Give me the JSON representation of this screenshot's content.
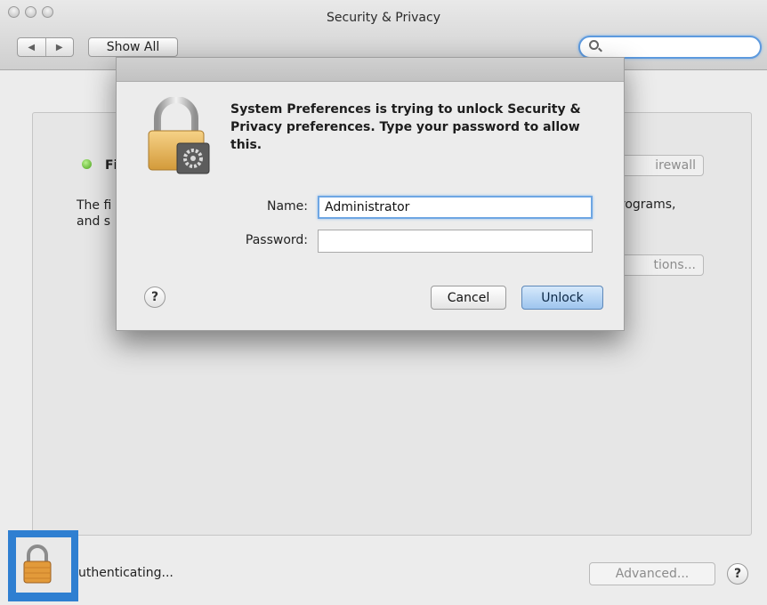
{
  "window": {
    "title": "Security & Privacy",
    "nav_back": "◀",
    "nav_forward": "▶",
    "show_all": "Show All",
    "search_placeholder": ""
  },
  "background": {
    "status_label": "Fi",
    "description_left_line1": "The fi",
    "description_left_line2": "and s",
    "description_right": "programs,",
    "firewall_button": "irewall",
    "options_button": "tions..."
  },
  "bottom": {
    "status": "uthenticating...",
    "advanced_button": "Advanced...",
    "help": "?"
  },
  "dialog": {
    "message": "System Preferences is trying to unlock Security & Privacy preferences. Type your password to allow this.",
    "name_label": "Name:",
    "name_value": "Administrator",
    "password_label": "Password:",
    "password_value": "",
    "help": "?",
    "cancel_button": "Cancel",
    "unlock_button": "Unlock"
  },
  "colors": {
    "accent": "#2f7fd1",
    "status_green": "#4aa41a",
    "unlock_button": "#9ec5ee"
  }
}
